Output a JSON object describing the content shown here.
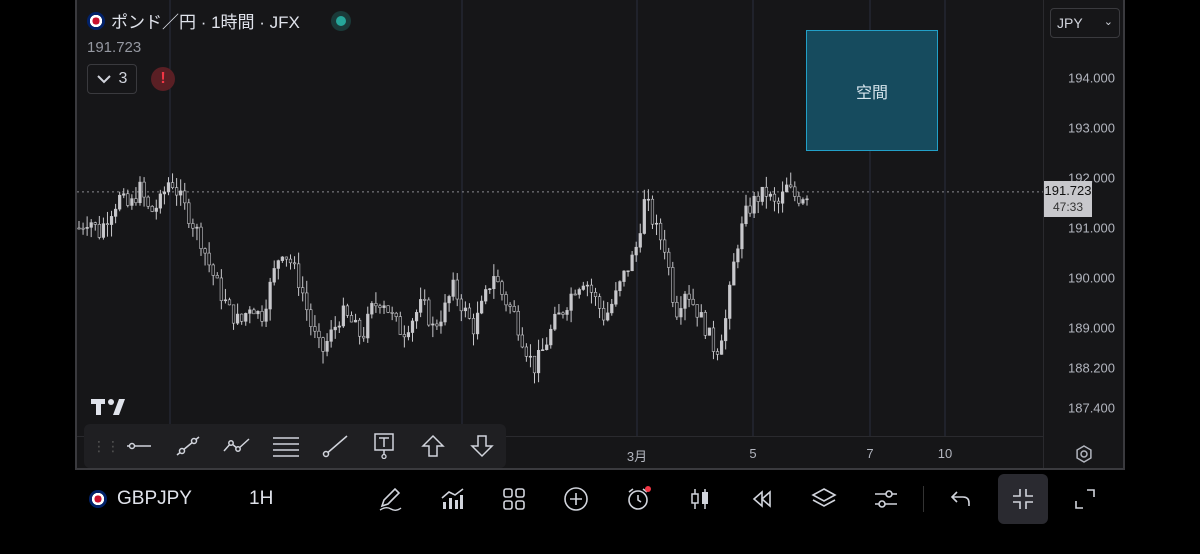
{
  "legend": {
    "symbol_title": "ポンド／円 · 1時間 · JFX",
    "price": "191.723",
    "indicator_count": "3"
  },
  "currency_select": {
    "value": "JPY"
  },
  "price_scale": {
    "ticks": [
      "194.000",
      "193.000",
      "192.000",
      "191.000",
      "190.000",
      "189.000",
      "188.200",
      "187.400"
    ],
    "last_price": "191.723",
    "countdown": "47:33"
  },
  "time_axis": {
    "ticks": [
      "3月",
      "5",
      "7",
      "10"
    ]
  },
  "annotation_box": {
    "label": "空間"
  },
  "bottom_bar": {
    "symbol": "GBPJPY",
    "interval": "1H"
  },
  "icons": {
    "drawing_toolbar": [
      "horizontal-line-icon",
      "trend-line-icon",
      "path-icon",
      "fib-retracement-icon",
      "ray-icon",
      "text-icon",
      "arrow-up-icon",
      "arrow-down-icon"
    ],
    "bottom_bar": [
      "pen-icon",
      "indicators-icon",
      "layout-icon",
      "plus-circle-icon",
      "alarm-icon",
      "candles-icon",
      "replay-icon",
      "layers-icon",
      "settings-sliders-icon",
      "undo-icon",
      "fullscreen-exit-icon",
      "fullscreen-icon"
    ]
  },
  "colors": {
    "background": "#161618",
    "candle": "#c8c8cc",
    "box_fill": "#164b5e",
    "box_border": "#22a0c8",
    "live": "#26a69a",
    "alert": "#f23645"
  },
  "chart_data": {
    "type": "candlestick",
    "symbol": "GBPJPY",
    "interval": "1H",
    "ylim": [
      187.0,
      194.6
    ],
    "y_ticks": [
      187.4,
      188.2,
      189.0,
      190.0,
      191.0,
      192.0,
      193.0,
      194.0
    ],
    "x_ticks": [
      "3月",
      "5",
      "7",
      "10"
    ],
    "last_price": 191.723,
    "approx_close_path": [
      191.0,
      191.2,
      190.9,
      191.3,
      191.6,
      191.4,
      191.8,
      191.3,
      191.5,
      192.0,
      191.6,
      191.2,
      190.8,
      190.2,
      189.7,
      189.3,
      189.1,
      189.5,
      189.2,
      189.9,
      190.6,
      190.3,
      189.8,
      189.0,
      188.5,
      188.9,
      189.3,
      189.1,
      188.8,
      189.4,
      189.6,
      189.2,
      188.9,
      189.2,
      189.5,
      189.0,
      189.3,
      189.8,
      189.4,
      189.0,
      189.5,
      190.1,
      189.6,
      189.3,
      188.7,
      188.2,
      188.6,
      189.1,
      189.4,
      189.8,
      190.0,
      189.6,
      189.2,
      189.6,
      190.1,
      190.5,
      191.6,
      191.0,
      190.6,
      189.3,
      189.8,
      189.4,
      189.0,
      188.5,
      189.2,
      190.6,
      191.3,
      191.6,
      191.7,
      191.4,
      191.8,
      191.6,
      191.7
    ]
  }
}
